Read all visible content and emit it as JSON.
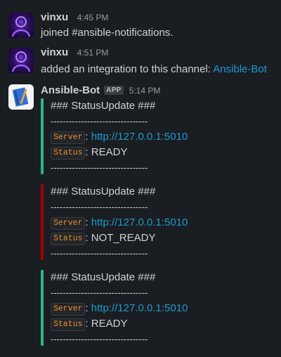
{
  "messages": [
    {
      "author": "vinxu",
      "time": "4:45 PM",
      "text": "joined #ansible-notifications."
    },
    {
      "author": "vinxu",
      "time": "4:51 PM",
      "text": "added an integration to this channel: ",
      "link": "Ansible-Bot"
    }
  ],
  "bot": {
    "author": "Ansible-Bot",
    "badge": "APP",
    "time": "5:14 PM",
    "attachments": [
      {
        "status_color": "#2eb67d",
        "title": "### StatusUpdate ###",
        "divider": "--------------------------------",
        "server_label": "Server",
        "server_value": "http://127.0.0.1:5010",
        "status_label": "Status",
        "status_value": "READY"
      },
      {
        "status_color": "#a30200",
        "title": "### StatusUpdate ###",
        "divider": "--------------------------------",
        "server_label": "Server",
        "server_value": "http://127.0.0.1:5010",
        "status_label": "Status",
        "status_value": "NOT_READY"
      },
      {
        "status_color": "#2eb67d",
        "title": "### StatusUpdate ###",
        "divider": "--------------------------------",
        "server_label": "Server",
        "server_value": "http://127.0.0.1:5010",
        "status_label": "Status",
        "status_value": "READY"
      }
    ]
  },
  "separator": ": "
}
